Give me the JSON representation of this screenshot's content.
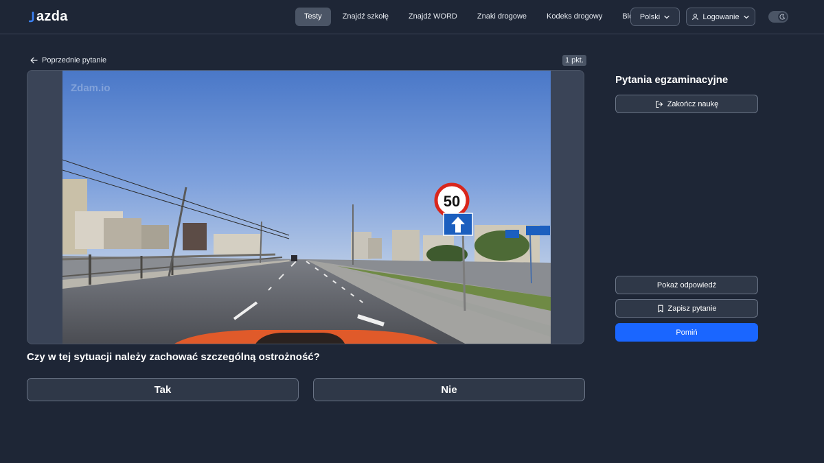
{
  "header": {
    "logo_text": "azda",
    "nav": [
      {
        "label": "Testy",
        "active": true
      },
      {
        "label": "Znajdź szkołę",
        "active": false
      },
      {
        "label": "Znajdź WORD",
        "active": false
      },
      {
        "label": "Znaki drogowe",
        "active": false
      },
      {
        "label": "Kodeks drogowy",
        "active": false
      },
      {
        "label": "Blog",
        "active": false
      }
    ],
    "language": "Polski",
    "login": "Logowanie"
  },
  "question": {
    "prev_label": "Poprzednie pytanie",
    "points": "1 pkt.",
    "watermark": "Zdam.io",
    "sign_speed": "50",
    "text": "Czy w tej sytuacji należy zachować szczególną ostrożność?",
    "answers": {
      "yes": "Tak",
      "no": "Nie"
    }
  },
  "sidebar": {
    "title": "Pytania egzaminacyjne",
    "end_label": "Zakończ naukę",
    "show_answer_label": "Pokaż odpowiedź",
    "save_label": "Zapisz pytanie",
    "skip_label": "Pomiń"
  },
  "colors": {
    "background": "#1e2636",
    "accent": "#1a66ff",
    "active_nav": "#4b5566"
  }
}
